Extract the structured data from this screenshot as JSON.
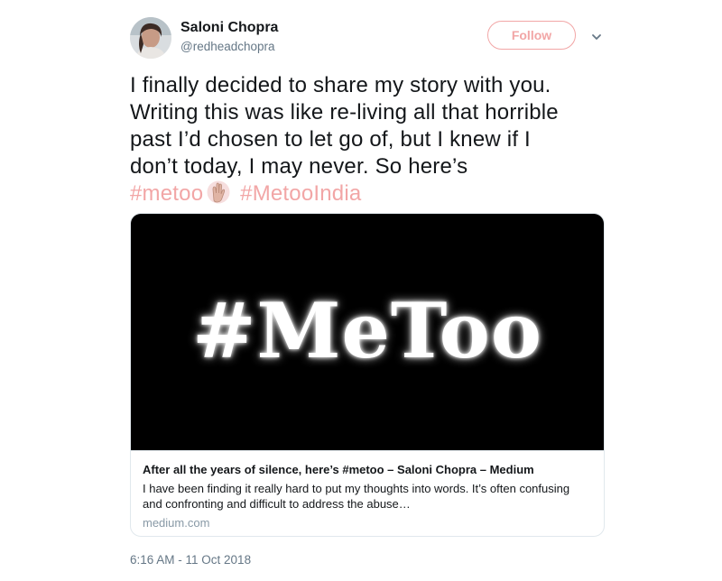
{
  "user": {
    "display_name": "Saloni Chopra",
    "handle": "@redheadchopra",
    "follow_label": "Follow"
  },
  "tweet": {
    "lines": [
      "I finally decided to share my story with you.",
      "Writing this was like re-living all that horrible",
      "past I’d chosen to let go of, but I knew if I",
      "don’t today, I may never. So here’s"
    ],
    "hashtag_1": "#metoo",
    "hashtag_2": "#MetooIndia",
    "emoji": "raised-hands-emoji"
  },
  "card": {
    "image_text": "#MeToo",
    "title": "After all the years of silence, here’s #metoo – Saloni Chopra – Medium",
    "description_lines": [
      "I have been finding it really hard to put my thoughts into words. It’s often confusing",
      "and confronting and difficult to address the abuse…"
    ],
    "domain": "medium.com"
  },
  "timestamp": "6:16 AM - 11 Oct 2018",
  "colors": {
    "accent": "#f2a6a6",
    "text": "#14171a",
    "muted": "#657786",
    "border": "#e1e8ed"
  },
  "icons": {
    "caret": "chevron-down-icon"
  }
}
